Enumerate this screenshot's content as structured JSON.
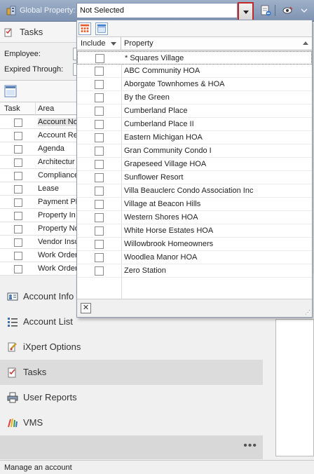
{
  "toolbar": {
    "global_property_label": "Global Property:",
    "property_value": "Not Selected"
  },
  "left": {
    "tasks_title": "Tasks",
    "employee_label": "Employee:",
    "expired_label": "Expired Through:",
    "grid_headers": [
      "Task",
      "Area"
    ],
    "areas": [
      "Account No",
      "Account Re",
      "Agenda",
      "Architectur",
      "Compliance",
      "Lease",
      "Payment Pla",
      "Property In",
      "Property No",
      "Vendor Insu",
      "Work Order",
      "Work Order"
    ]
  },
  "nav": {
    "items": [
      {
        "label": "Account Info",
        "icon": "account-info-icon"
      },
      {
        "label": "Account List",
        "icon": "account-list-icon"
      },
      {
        "label": "iXpert Options",
        "icon": "options-icon"
      },
      {
        "label": "Tasks",
        "icon": "tasks-icon"
      },
      {
        "label": "User Reports",
        "icon": "printer-icon"
      },
      {
        "label": "VMS",
        "icon": "vms-icon"
      }
    ],
    "more": "•••"
  },
  "status": {
    "text": "Manage an account"
  },
  "popup": {
    "col_include": "Include",
    "col_property": "Property",
    "close_glyph": "✕",
    "properties": [
      "* Squares Village",
      "ABC Community HOA",
      "Aborgate Townhomes & HOA",
      "By the Green",
      "Cumberland Place",
      "Cumberland Place II",
      "Eastern Michigan HOA",
      "Gran Community Condo I",
      "Grapeseed Village  HOA",
      "Sunflower Resort",
      "Villa Beauclerc Condo Association Inc",
      "Village at Beacon Hills",
      "Western Shores HOA",
      "White Horse Estates HOA",
      "Willowbrook Homeowners",
      "Woodlea Manor HOA",
      "Zero Station"
    ]
  },
  "colors": {
    "accent": "#c0282a",
    "toolbar": "#8a9dbb"
  }
}
